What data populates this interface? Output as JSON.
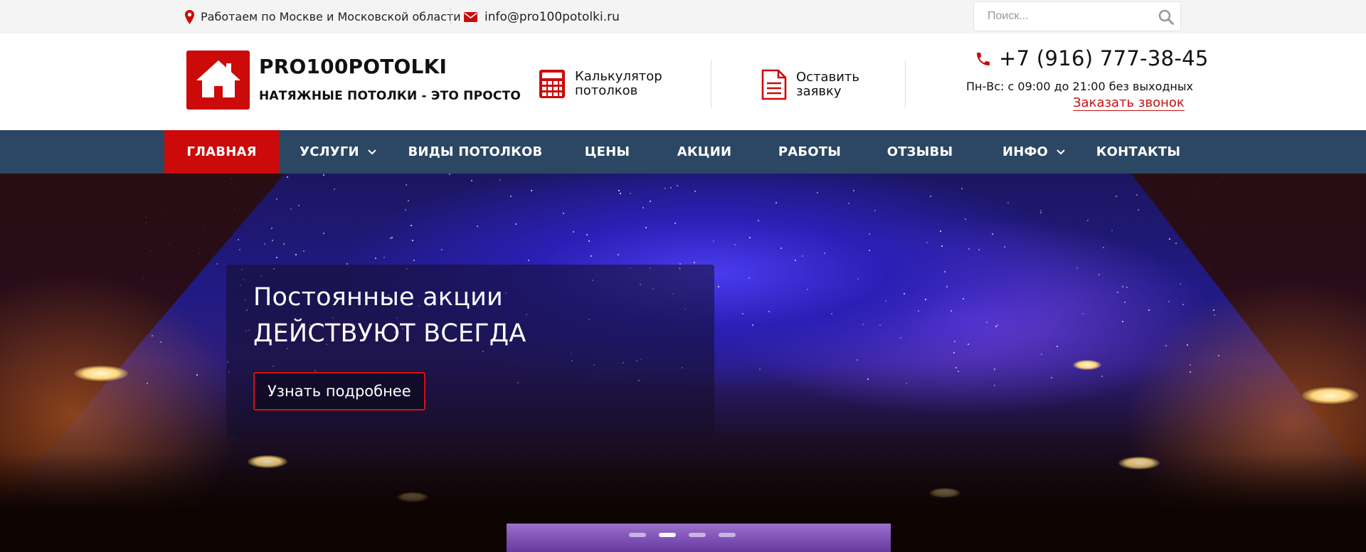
{
  "topbar": {
    "location_text": "Работаем по Москве и Московской области",
    "email": "info@pro100potolki.ru",
    "search": {
      "placeholder": "Поиск..."
    }
  },
  "header": {
    "brand": "PRO100POTOLKI",
    "tagline": "НАТЯЖНЫЕ ПОТОЛКИ - ЭТО ПРОСТО",
    "calculator": {
      "line1": "Калькулятор",
      "line2": "потолков"
    },
    "request": {
      "line1": "Оставить",
      "line2": "заявку"
    },
    "phone": "+7 (916) 777-38-45",
    "hours": "Пн-Вс: с 09:00 до 21:00 без выходных",
    "callback": "Заказать звонок"
  },
  "nav": {
    "items": [
      {
        "label": "ГЛАВНАЯ",
        "active": true
      },
      {
        "label": "УСЛУГИ",
        "dropdown": true
      },
      {
        "label": "ВИДЫ ПОТОЛКОВ"
      },
      {
        "label": "ЦЕНЫ"
      },
      {
        "label": "АКЦИИ"
      },
      {
        "label": "РАБОТЫ"
      },
      {
        "label": "ОТЗЫВЫ"
      },
      {
        "label": "ИНФО",
        "dropdown": true
      },
      {
        "label": "КОНТАКТЫ"
      }
    ]
  },
  "hero": {
    "title_line1": "Постоянные акции",
    "title_line2": "ДЕЙСТВУЮТ ВСЕГДА",
    "button": "Узнать подробнее",
    "slides": 4,
    "active_slide": 2
  },
  "colors": {
    "accent": "#cc0a0a",
    "nav_bg": "#2c4763",
    "topbar_bg": "#f4f4f4"
  }
}
